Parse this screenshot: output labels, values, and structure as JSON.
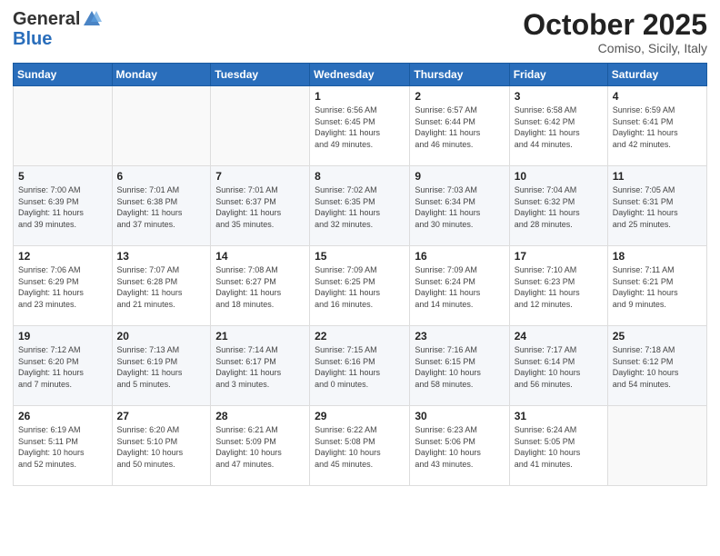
{
  "header": {
    "logo_general": "General",
    "logo_blue": "Blue",
    "month": "October 2025",
    "location": "Comiso, Sicily, Italy"
  },
  "weekdays": [
    "Sunday",
    "Monday",
    "Tuesday",
    "Wednesday",
    "Thursday",
    "Friday",
    "Saturday"
  ],
  "weeks": [
    [
      {
        "day": "",
        "info": ""
      },
      {
        "day": "",
        "info": ""
      },
      {
        "day": "",
        "info": ""
      },
      {
        "day": "1",
        "info": "Sunrise: 6:56 AM\nSunset: 6:45 PM\nDaylight: 11 hours\nand 49 minutes."
      },
      {
        "day": "2",
        "info": "Sunrise: 6:57 AM\nSunset: 6:44 PM\nDaylight: 11 hours\nand 46 minutes."
      },
      {
        "day": "3",
        "info": "Sunrise: 6:58 AM\nSunset: 6:42 PM\nDaylight: 11 hours\nand 44 minutes."
      },
      {
        "day": "4",
        "info": "Sunrise: 6:59 AM\nSunset: 6:41 PM\nDaylight: 11 hours\nand 42 minutes."
      }
    ],
    [
      {
        "day": "5",
        "info": "Sunrise: 7:00 AM\nSunset: 6:39 PM\nDaylight: 11 hours\nand 39 minutes."
      },
      {
        "day": "6",
        "info": "Sunrise: 7:01 AM\nSunset: 6:38 PM\nDaylight: 11 hours\nand 37 minutes."
      },
      {
        "day": "7",
        "info": "Sunrise: 7:01 AM\nSunset: 6:37 PM\nDaylight: 11 hours\nand 35 minutes."
      },
      {
        "day": "8",
        "info": "Sunrise: 7:02 AM\nSunset: 6:35 PM\nDaylight: 11 hours\nand 32 minutes."
      },
      {
        "day": "9",
        "info": "Sunrise: 7:03 AM\nSunset: 6:34 PM\nDaylight: 11 hours\nand 30 minutes."
      },
      {
        "day": "10",
        "info": "Sunrise: 7:04 AM\nSunset: 6:32 PM\nDaylight: 11 hours\nand 28 minutes."
      },
      {
        "day": "11",
        "info": "Sunrise: 7:05 AM\nSunset: 6:31 PM\nDaylight: 11 hours\nand 25 minutes."
      }
    ],
    [
      {
        "day": "12",
        "info": "Sunrise: 7:06 AM\nSunset: 6:29 PM\nDaylight: 11 hours\nand 23 minutes."
      },
      {
        "day": "13",
        "info": "Sunrise: 7:07 AM\nSunset: 6:28 PM\nDaylight: 11 hours\nand 21 minutes."
      },
      {
        "day": "14",
        "info": "Sunrise: 7:08 AM\nSunset: 6:27 PM\nDaylight: 11 hours\nand 18 minutes."
      },
      {
        "day": "15",
        "info": "Sunrise: 7:09 AM\nSunset: 6:25 PM\nDaylight: 11 hours\nand 16 minutes."
      },
      {
        "day": "16",
        "info": "Sunrise: 7:09 AM\nSunset: 6:24 PM\nDaylight: 11 hours\nand 14 minutes."
      },
      {
        "day": "17",
        "info": "Sunrise: 7:10 AM\nSunset: 6:23 PM\nDaylight: 11 hours\nand 12 minutes."
      },
      {
        "day": "18",
        "info": "Sunrise: 7:11 AM\nSunset: 6:21 PM\nDaylight: 11 hours\nand 9 minutes."
      }
    ],
    [
      {
        "day": "19",
        "info": "Sunrise: 7:12 AM\nSunset: 6:20 PM\nDaylight: 11 hours\nand 7 minutes."
      },
      {
        "day": "20",
        "info": "Sunrise: 7:13 AM\nSunset: 6:19 PM\nDaylight: 11 hours\nand 5 minutes."
      },
      {
        "day": "21",
        "info": "Sunrise: 7:14 AM\nSunset: 6:17 PM\nDaylight: 11 hours\nand 3 minutes."
      },
      {
        "day": "22",
        "info": "Sunrise: 7:15 AM\nSunset: 6:16 PM\nDaylight: 11 hours\nand 0 minutes."
      },
      {
        "day": "23",
        "info": "Sunrise: 7:16 AM\nSunset: 6:15 PM\nDaylight: 10 hours\nand 58 minutes."
      },
      {
        "day": "24",
        "info": "Sunrise: 7:17 AM\nSunset: 6:14 PM\nDaylight: 10 hours\nand 56 minutes."
      },
      {
        "day": "25",
        "info": "Sunrise: 7:18 AM\nSunset: 6:12 PM\nDaylight: 10 hours\nand 54 minutes."
      }
    ],
    [
      {
        "day": "26",
        "info": "Sunrise: 6:19 AM\nSunset: 5:11 PM\nDaylight: 10 hours\nand 52 minutes."
      },
      {
        "day": "27",
        "info": "Sunrise: 6:20 AM\nSunset: 5:10 PM\nDaylight: 10 hours\nand 50 minutes."
      },
      {
        "day": "28",
        "info": "Sunrise: 6:21 AM\nSunset: 5:09 PM\nDaylight: 10 hours\nand 47 minutes."
      },
      {
        "day": "29",
        "info": "Sunrise: 6:22 AM\nSunset: 5:08 PM\nDaylight: 10 hours\nand 45 minutes."
      },
      {
        "day": "30",
        "info": "Sunrise: 6:23 AM\nSunset: 5:06 PM\nDaylight: 10 hours\nand 43 minutes."
      },
      {
        "day": "31",
        "info": "Sunrise: 6:24 AM\nSunset: 5:05 PM\nDaylight: 10 hours\nand 41 minutes."
      },
      {
        "day": "",
        "info": ""
      }
    ]
  ]
}
